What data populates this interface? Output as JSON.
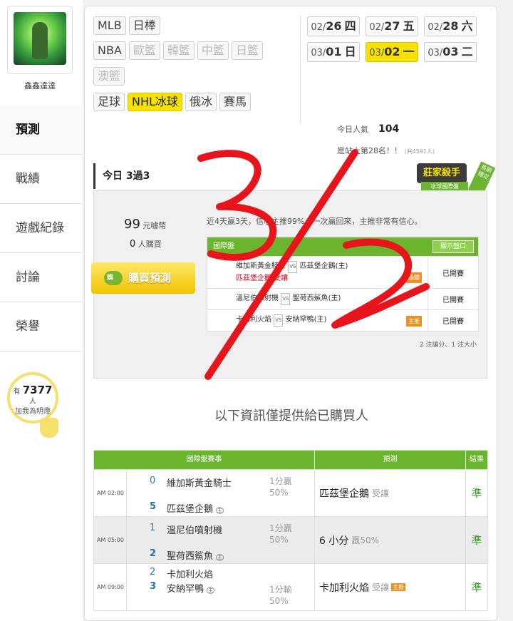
{
  "user": {
    "name": "鑫鑫達達"
  },
  "nav": [
    {
      "label": "預測",
      "active": true
    },
    {
      "label": "戰績"
    },
    {
      "label": "遊戲紀錄"
    },
    {
      "label": "討論"
    },
    {
      "label": "榮譽"
    }
  ],
  "fans": {
    "prefix": "有",
    "count": "7377",
    "unit": "人",
    "caption": "加我為明燈"
  },
  "sports": {
    "row1": [
      "MLB",
      "日棒"
    ],
    "row2": [
      "NBA",
      "歐籃",
      "韓籃",
      "中籃",
      "日籃"
    ],
    "row3": [
      "澳籃"
    ],
    "row4": [
      "足球",
      "NHL冰球",
      "俄冰",
      "賽馬"
    ]
  },
  "dates": [
    {
      "prefix": "02/",
      "day": "26",
      "weekday": "四"
    },
    {
      "prefix": "02/",
      "day": "27",
      "weekday": "五"
    },
    {
      "prefix": "02/",
      "day": "28",
      "weekday": "六"
    },
    {
      "prefix": "03/",
      "day": "01",
      "weekday": "日"
    },
    {
      "prefix": "03/",
      "day": "02",
      "weekday": "一"
    },
    {
      "prefix": "03/",
      "day": "03",
      "weekday": "二"
    }
  ],
  "stats": {
    "popularity_label": "今日人氣",
    "popularity": "104",
    "rank_text": "是站上第28名！！",
    "rank_small": "(共4591人)"
  },
  "badge": {
    "main": "莊家殺手",
    "sub": "冰球國際盤",
    "side": "長期穩定"
  },
  "today": {
    "label": "今日 3過3"
  },
  "purchase": {
    "price": "99",
    "price_unit": "元噱幣",
    "buyers": "0",
    "buyers_unit": "人購買",
    "button": "購買預測",
    "button_icon": "娛",
    "summary": "近4天贏3天，信心主推99%，一次贏回來，主推非常有信心。"
  },
  "mini_table": {
    "title": "國際盤",
    "show_button": "顯示盤口",
    "rows": [
      {
        "away": "維加斯黃金騎士",
        "home": "匹茲堡企鵝(主)",
        "pick": "匹茲堡企鵝 受讓",
        "tag": "過關",
        "status": "已開賽"
      },
      {
        "away": "溫尼伯噴射機",
        "home": "聖荷西鯊魚(主)",
        "pick": "",
        "tag": "",
        "status": "已開賽"
      },
      {
        "away": "卡加利火焰",
        "home": "安納罕鴨(主)",
        "pick": "",
        "tag": "主推",
        "status": "已開賽"
      }
    ],
    "vs": "VS",
    "note": "2 注讓分、1 注大小"
  },
  "info_note": "以下資訊僅提供給已購買人",
  "results": {
    "headers": [
      "國際盤賽事",
      "預測",
      "結果"
    ],
    "home_mark": "主",
    "rows": [
      {
        "time": "AM 02:00",
        "team1": "維加斯黃金騎士",
        "score1": "0",
        "team2": "匹茲堡企鵝",
        "score2": "5",
        "spread_a": "1分贏",
        "spread_b": "50%",
        "pick": "匹茲堡企鵝",
        "pick_note": "受讓",
        "pick_tag": "",
        "result": "準"
      },
      {
        "time": "AM 05:00",
        "team1": "溫尼伯噴射機",
        "score1": "1",
        "team2": "聖荷西鯊魚",
        "score2": "2",
        "spread_a": "1分贏",
        "spread_b": "50%",
        "pick": "6 小分",
        "pick_note": "贏50%",
        "pick_tag": "",
        "result": "準"
      },
      {
        "time": "AM 09:00",
        "team1": "卡加利火焰",
        "score1": "2",
        "team2": "安納罕鴨",
        "score2": "3",
        "spread_a": "1分輸",
        "spread_b": "50%",
        "pick": "卡加利火焰",
        "pick_note": "受讓",
        "pick_tag": "主推",
        "result": "準"
      }
    ]
  },
  "overlay": {
    "text": "3/2",
    "color": "#e8141c"
  }
}
